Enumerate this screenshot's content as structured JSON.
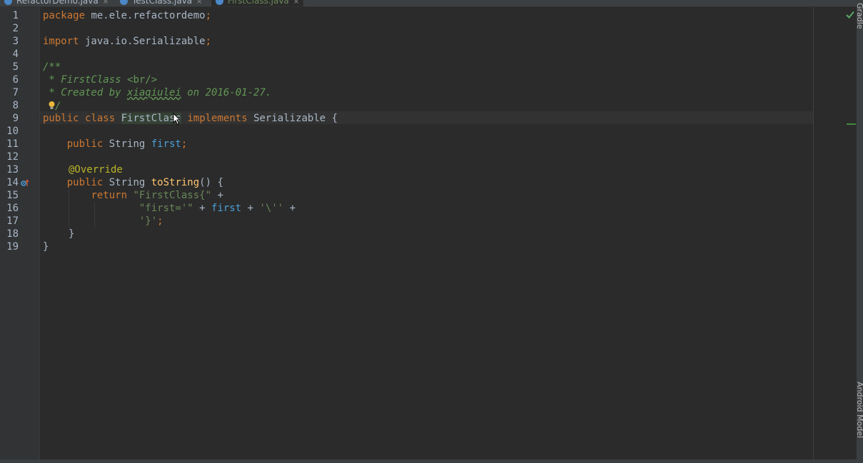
{
  "tabs": [
    {
      "label": "RefactorDemo.java",
      "close": "×"
    },
    {
      "label": "TestClass.java",
      "close": "×"
    },
    {
      "label": "FirstClass.java",
      "close": "×",
      "active": true
    }
  ],
  "side_tools": [
    "Gradle",
    "Android Model"
  ],
  "line_numbers": [
    "1",
    "2",
    "3",
    "4",
    "5",
    "6",
    "7",
    "8",
    "9",
    "10",
    "11",
    "12",
    "13",
    "14",
    "15",
    "16",
    "17",
    "18",
    "19"
  ],
  "code": {
    "l1": {
      "kw": "package",
      "rest": " me.ele.refactordemo",
      "semi": ";"
    },
    "l3": {
      "kw": "import",
      "rest": " java.io.Serializable",
      "semi": ";"
    },
    "l5": "/**",
    "l6": {
      "pre": " * FirstClass ",
      "tag": "<br/>"
    },
    "l7": {
      "pre": " * Created by ",
      "author": "xiaqiulei",
      "post": " on 2016-01-27."
    },
    "l8": "/",
    "l9": {
      "kw1": "public",
      "kw2": "class",
      "name": "FirstClass",
      "kw3": "implements",
      "iface": "Serializable",
      "brace": " {"
    },
    "l11": {
      "kw": "public",
      "type": " String ",
      "field": "first",
      "semi": ";"
    },
    "l13": "@Override",
    "l14": {
      "kw": "public",
      "type": " String ",
      "method": "toString",
      "rest": "() {"
    },
    "l15": {
      "kw": "return",
      "str": "\"FirstClass{\"",
      "op": " +"
    },
    "l16": {
      "str1": "\"first='\"",
      "op1": " + ",
      "field": "first",
      "op2": " + ",
      "str2": "'\\''",
      "op3": " +"
    },
    "l17": {
      "str": "'}'",
      "semi": ";"
    },
    "l18": "}",
    "l19": "}"
  },
  "colors": {
    "background": "#2b2b2b",
    "keyword": "#cc7832",
    "string": "#6a8759",
    "comment": "#629755",
    "annotation": "#bbb529",
    "method": "#ffc66d",
    "field": "#4a9fd8",
    "text": "#a9b7c6"
  },
  "icons": {
    "line8": "lightbulb-icon",
    "line14": "override-method-icon",
    "status": "checkmark-icon",
    "tab": "java-class-icon",
    "cursor": "mouse-cursor-icon"
  }
}
